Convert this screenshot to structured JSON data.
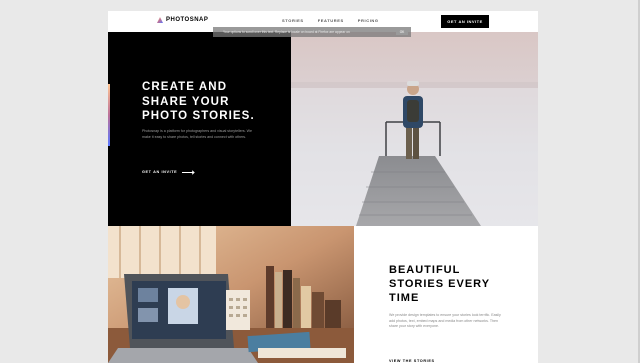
{
  "header": {
    "logo_text": "PHOTOSNAP",
    "nav": [
      "STORIES",
      "FEATURES",
      "PRICING"
    ],
    "invite_label": "GET AN INVITE"
  },
  "translate_bar": {
    "text": "Your options to scroll over this text. Replace is locale on board at Firefox are appear on",
    "ok_label": "OK"
  },
  "hero": {
    "title_lines": [
      "CREATE AND",
      "SHARE YOUR",
      "PHOTO STORIES."
    ],
    "description": "Photosnap is a platform for photographers and visual storytellers. We make it easy to share photos, tell stories and connect with others.",
    "link_label": "GET AN INVITE"
  },
  "feature": {
    "title_lines": [
      "BEAUTIFUL",
      "STORIES EVERY",
      "TIME"
    ],
    "description": "We provide design templates to ensure your stories look terrific. Easily add photos, text, embed maps and media from other networks. Then share your story with everyone.",
    "link_label": "VIEW THE STORIES"
  },
  "colors": {
    "brand_gradient": [
      "#ffc593",
      "#bc7198",
      "#5a77ff"
    ],
    "dark": "#000000"
  },
  "icons": [
    "logo-mark-icon",
    "arrow-right-icon"
  ]
}
